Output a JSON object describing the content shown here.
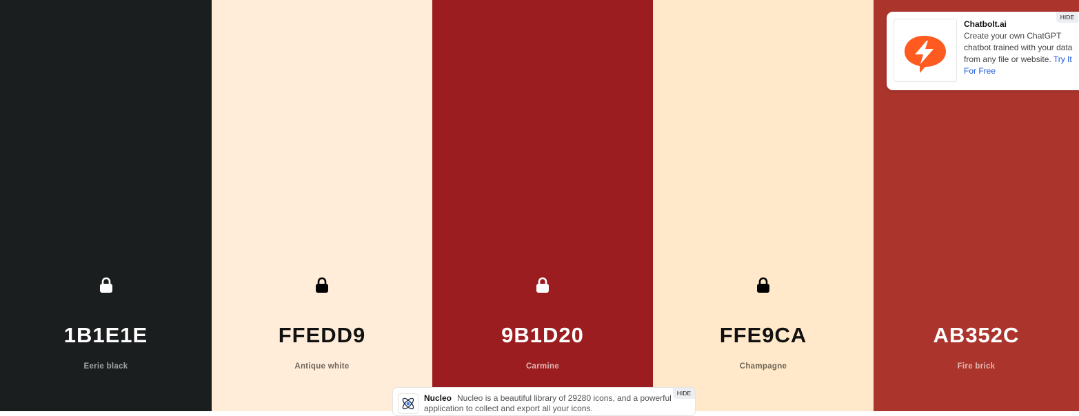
{
  "palette": {
    "colors": [
      {
        "hex": "1B1E1E",
        "name": "Eerie black",
        "bg": "#1b1e1e",
        "text_color": "#ffffff",
        "name_color": "#a3a5a5",
        "lock_color": "#ffffff"
      },
      {
        "hex": "FFEDD9",
        "name": "Antique white",
        "bg": "#ffedd9",
        "text_color": "#111111",
        "name_color": "#6e655c",
        "lock_color": "#000000"
      },
      {
        "hex": "9B1D20",
        "name": "Carmine",
        "bg": "#9b1d20",
        "text_color": "#ffffff",
        "name_color": "#e0b6b7",
        "lock_color": "#ffffff"
      },
      {
        "hex": "FFE9CA",
        "name": "Champagne",
        "bg": "#ffe9ca",
        "text_color": "#111111",
        "name_color": "#6d6455",
        "lock_color": "#000000"
      },
      {
        "hex": "AB352C",
        "name": "Fire brick",
        "bg": "#ab352c",
        "text_color": "#ffffff",
        "name_color": "#e3b9b5",
        "lock_color": "#ffffff"
      }
    ],
    "lock_icon": "lock-icon"
  },
  "ad": {
    "title": "Chatbolt.ai",
    "body": "Create your own ChatGPT chatbot trained with your data from any file or website.",
    "cta": "Try It For Free",
    "hide": "HIDE",
    "logo_icon": "chatbolt-logo",
    "logo_color": "#ff5a1f"
  },
  "bar": {
    "title": "Nucleo",
    "text": "Nucleo is a beautiful library of 29280 icons, and a powerful application to collect and export all your icons.",
    "hide": "HIDE",
    "icon": "nucleo-atom-icon"
  }
}
